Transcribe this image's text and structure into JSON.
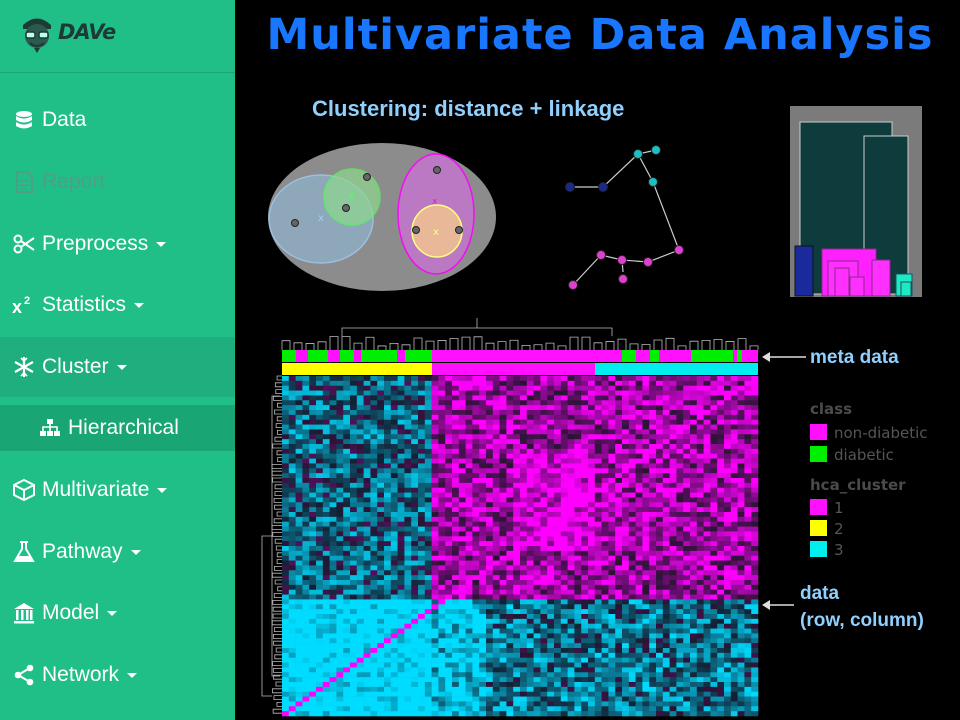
{
  "brand": {
    "name": "DAVe"
  },
  "nav": [
    {
      "label": "Data",
      "icon": "database-icon",
      "state": "normal",
      "dropdown": false
    },
    {
      "label": "Report",
      "icon": "file-text-icon",
      "state": "disabled",
      "dropdown": false
    },
    {
      "label": "Preprocess",
      "icon": "scissors-icon",
      "state": "normal",
      "dropdown": true
    },
    {
      "label": "Statistics",
      "icon": "superscript-x2-icon",
      "state": "normal",
      "dropdown": true
    },
    {
      "label": "Cluster",
      "icon": "snowflake-icon",
      "state": "active",
      "dropdown": true
    },
    {
      "label": "Hierarchical",
      "icon": "sitemap-icon",
      "state": "sub",
      "dropdown": false
    },
    {
      "label": "Multivariate",
      "icon": "cube-icon",
      "state": "normal",
      "dropdown": true
    },
    {
      "label": "Pathway",
      "icon": "flask-icon",
      "state": "normal",
      "dropdown": true
    },
    {
      "label": "Model",
      "icon": "bank-icon",
      "state": "normal",
      "dropdown": true
    },
    {
      "label": "Network",
      "icon": "share-icon",
      "state": "normal",
      "dropdown": true
    }
  ],
  "main": {
    "title": "Multivariate Data Analysis",
    "subtitle": "Clustering: distance + linkage",
    "annotations": {
      "meta": "meta data",
      "data_line1": "data",
      "data_line2": "(row, column)"
    }
  },
  "legend": {
    "class_title": "class",
    "class_items": [
      {
        "label": "non-diabetic",
        "color": "#ff10ff"
      },
      {
        "label": "diabetic",
        "color": "#00ee00"
      }
    ],
    "cluster_title": "hca_cluster",
    "cluster_items": [
      {
        "label": "1",
        "color": "#ff10ff"
      },
      {
        "label": "2",
        "color": "#ffff00"
      },
      {
        "label": "3",
        "color": "#00eeee"
      }
    ]
  },
  "colors": {
    "sidebar": "#21bf88",
    "title": "#1976ff",
    "accent_magenta": "#ff10ff",
    "accent_cyan": "#00eeee",
    "accent_yellow": "#ffff00",
    "accent_green": "#00ee00"
  }
}
